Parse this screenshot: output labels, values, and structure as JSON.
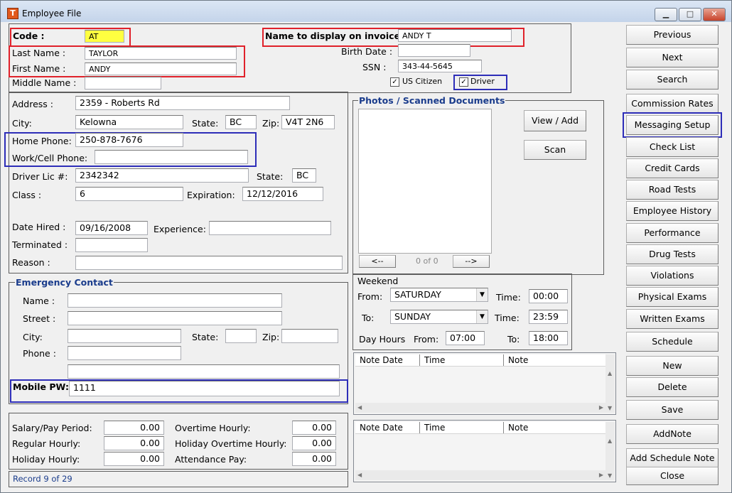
{
  "window": {
    "title": "Employee File",
    "minimize": "▁",
    "maximize": "□",
    "close": "✕",
    "app_icon": "T"
  },
  "header": {
    "code_label": "Code :",
    "code_value": "AT",
    "display_name_label": "Name to display on invoice :",
    "display_name_value": "ANDY T",
    "last_name_label": "Last Name :",
    "last_name_value": "TAYLOR",
    "first_name_label": "First Name :",
    "first_name_value": "ANDY",
    "middle_name_label": "Middle Name :",
    "middle_name_value": "",
    "birth_date_label": "Birth Date :",
    "birth_date_value": "",
    "ssn_label": "SSN :",
    "ssn_value": "343-44-5645",
    "us_citizen_label": "US Citizen",
    "us_citizen_checked": "✓",
    "driver_label": "Driver",
    "driver_checked": "✓"
  },
  "address": {
    "address_label": "Address :",
    "address_value": "2359 - Roberts Rd",
    "city_label": "City:",
    "city_value": "Kelowna",
    "state_label": "State:",
    "state_value": "BC",
    "zip_label": "Zip:",
    "zip_value": "V4T 2N6",
    "home_phone_label": "Home Phone:",
    "home_phone_value": "250-878-7676",
    "work_phone_label": "Work/Cell Phone:",
    "work_phone_value": "",
    "driver_lic_label": "Driver Lic #:",
    "driver_lic_value": "2342342",
    "lic_state_label": "State:",
    "lic_state_value": "BC",
    "class_label": "Class :",
    "class_value": "6",
    "expiration_label": "Expiration:",
    "expiration_value": "12/12/2016",
    "date_hired_label": "Date Hired :",
    "date_hired_value": "09/16/2008",
    "experience_label": "Experience:",
    "experience_value": "",
    "terminated_label": "Terminated :",
    "terminated_value": "",
    "reason_label": "Reason :",
    "reason_value": ""
  },
  "emergency": {
    "title": "Emergency Contact",
    "name_label": "Name :",
    "name_value": "",
    "street_label": "Street :",
    "street_value": "",
    "city_label": "City:",
    "city_value": "",
    "state_label": "State:",
    "state_value": "",
    "zip_label": "Zip:",
    "zip_value": "",
    "phone_label": "Phone :",
    "phone_value": "",
    "extra_value": "",
    "mobile_pw_label": "Mobile PW:",
    "mobile_pw_value": "1111"
  },
  "pay": {
    "salary_label": "Salary/Pay Period:",
    "salary_value": "0.00",
    "regular_label": "Regular Hourly:",
    "regular_value": "0.00",
    "holiday_label": "Holiday Hourly:",
    "holiday_value": "0.00",
    "overtime_label": "Overtime Hourly:",
    "overtime_value": "0.00",
    "holiday_ot_label": "Holiday Overtime Hourly:",
    "holiday_ot_value": "0.00",
    "attendance_label": "Attendance Pay:",
    "attendance_value": "0.00"
  },
  "status": {
    "record": "Record 9 of 29"
  },
  "photos": {
    "title": "Photos / Scanned Documents",
    "view_add": "View / Add",
    "scan": "Scan",
    "prev": "<--",
    "counter": "0 of 0",
    "next": "-->"
  },
  "weekend": {
    "title": "Weekend",
    "from_label": "From:",
    "from_day": "SATURDAY",
    "to_label": "To:",
    "to_day": "SUNDAY",
    "time1_label": "Time:",
    "time1_value": "00:00",
    "time2_label": "Time:",
    "time2_value": "23:59",
    "day_hours_label": "Day Hours",
    "dh_from_label": "From:",
    "dh_from_value": "07:00",
    "dh_to_label": "To:",
    "dh_to_value": "18:00"
  },
  "notes_grid1": {
    "columns": [
      "Note Date",
      "Time",
      "Note"
    ]
  },
  "notes_grid2": {
    "columns": [
      "Note Date",
      "Time",
      "Note"
    ]
  },
  "buttons": {
    "previous": "Previous",
    "next": "Next",
    "search": "Search",
    "commission": "Commission Rates",
    "messaging": "Messaging Setup",
    "checklist": "Check List",
    "credit_cards": "Credit Cards",
    "road_tests": "Road Tests",
    "history": "Employee History",
    "performance": "Performance",
    "drug_tests": "Drug Tests",
    "violations": "Violations",
    "physical": "Physical Exams",
    "written": "Written Exams",
    "schedule": "Schedule",
    "new": "New",
    "delete": "Delete",
    "save": "Save",
    "addnote": "AddNote",
    "add_schedule_note": "Add Schedule Note",
    "close": "Close"
  },
  "colors": {
    "highlight_red": "#e0212a",
    "highlight_blue": "#2d2db8",
    "code_field_bg": "#ffff40",
    "group_title": "#1a3c8c"
  }
}
